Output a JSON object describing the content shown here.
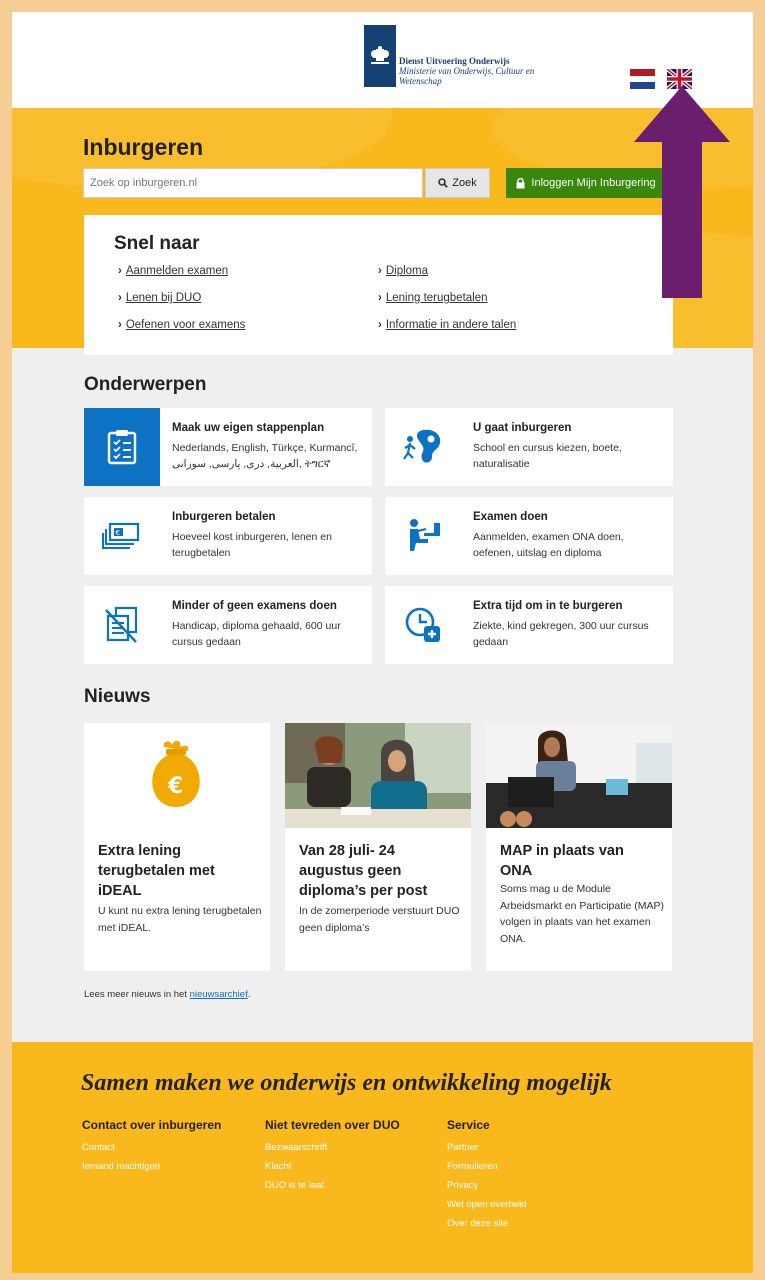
{
  "header": {
    "org_line1": "Dienst Uitvoering Onderwijs",
    "org_line2": "Ministerie van Onderwijs, Cultuur en",
    "org_line3": "Wetenschap"
  },
  "hero": {
    "title": "Inburgeren",
    "search_placeholder": "Zoek op inburgeren.nl",
    "search_button": "Zoek",
    "login_button": "Inloggen Mijn Inburgering"
  },
  "snel": {
    "title": "Snel naar",
    "links": [
      "Aanmelden examen",
      "Diploma",
      "Lenen bij DUO",
      "Lening terugbetalen",
      "Oefenen voor examens",
      "Informatie in andere talen"
    ]
  },
  "onderwerpen": {
    "title": "Onderwerpen",
    "cards": [
      {
        "title": "Maak uw eigen stappenplan",
        "desc": "Nederlands, English, Türkçe, Kurmancî, العربية, دری, پارسی, سورانی, ትግርኛ",
        "icon": "clipboard-checklist-icon"
      },
      {
        "title": "U gaat inburgeren",
        "desc": "School en cursus kiezen, boete, naturalisatie",
        "icon": "running-person-map-icon"
      },
      {
        "title": "Inburgeren betalen",
        "desc": "Hoeveel kost inburgeren, lenen en terugbetalen",
        "icon": "euro-banknote-icon"
      },
      {
        "title": "Examen doen",
        "desc": "Aanmelden, examen ONA doen, oefenen, uitslag en diploma",
        "icon": "person-at-desk-icon"
      },
      {
        "title": "Minder of geen examens doen",
        "desc": "Handicap, diploma gehaald, 600 uur cursus gedaan",
        "icon": "crossed-document-icon"
      },
      {
        "title": "Extra tijd om in te burgeren",
        "desc": "Ziekte, kind gekregen, 300 uur cursus gedaan",
        "icon": "clock-plus-icon"
      }
    ]
  },
  "nieuws": {
    "title": "Nieuws",
    "items": [
      {
        "title": "Extra lening terugbetalen met iDEAL",
        "desc": "U kunt nu extra lening terugbetalen met iDEAL."
      },
      {
        "title": "Van 28 juli- 24 augustus geen diploma’s per post",
        "desc": "In de zomerperiode verstuurt DUO geen diploma’s"
      },
      {
        "title": "MAP in plaats van ONA",
        "desc": "Soms mag u de Module Arbeidsmarkt en Participatie (MAP) volgen in plaats van het examen ONA."
      }
    ],
    "more_prefix": "Lees meer nieuws in het ",
    "more_link": "nieuwsarchief",
    "more_suffix": "."
  },
  "footer": {
    "slogan": "Samen maken we onderwijs en ontwikkeling mogelijk",
    "columns": [
      {
        "title": "Contact over inburgeren",
        "links": [
          "Contact",
          "Iemand machtigen"
        ]
      },
      {
        "title": "Niet tevreden over DUO",
        "links": [
          "Bezwaarschrift",
          "Klacht",
          "DUO is te laat"
        ]
      },
      {
        "title": "Service",
        "links": [
          "Partner",
          "Formulieren",
          "Privacy",
          "Wet open overheid",
          "Over deze site"
        ]
      }
    ]
  },
  "colors": {
    "accent_yellow": "#f9b91d",
    "duo_blue": "#154273",
    "login_green": "#39870c",
    "icon_blue": "#0b72c4",
    "annotation_purple": "#6b1d6e"
  }
}
